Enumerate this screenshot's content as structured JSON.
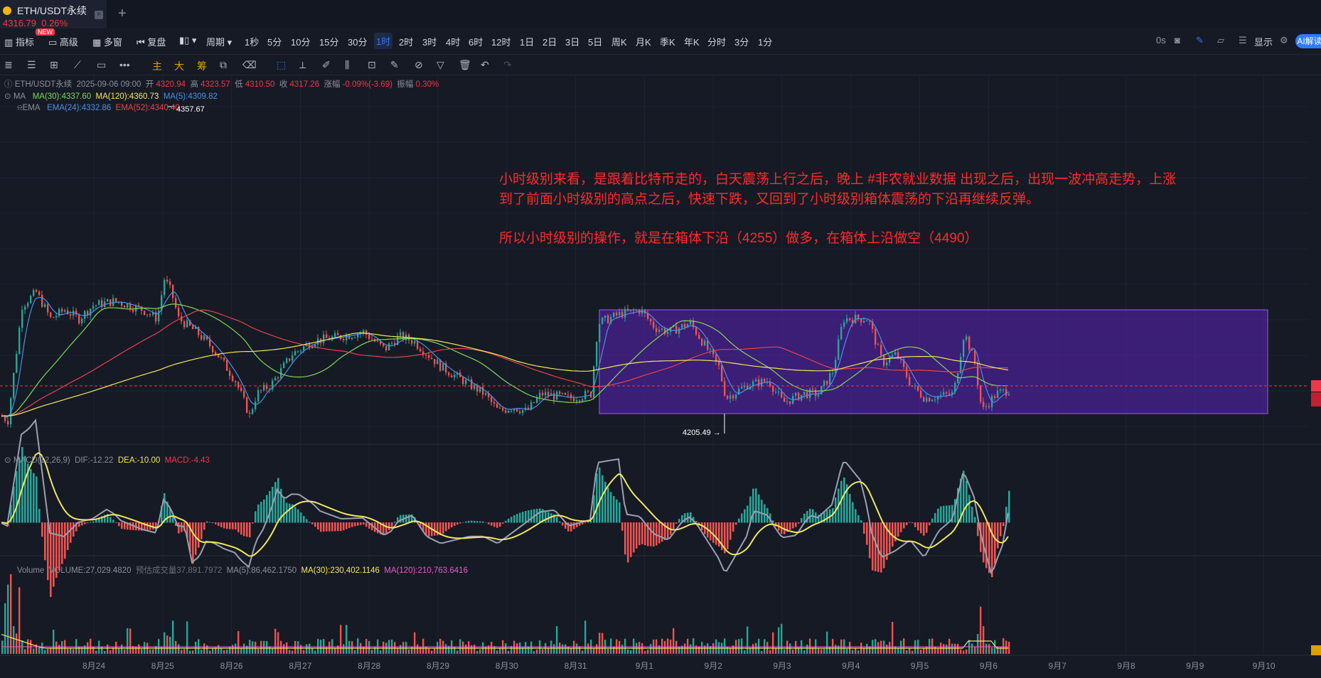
{
  "tab": {
    "symbol": "ETH/USDT永续",
    "price": "4316.79",
    "change": "0.26%",
    "close": "×",
    "new_tab": "+"
  },
  "toolbar": {
    "new_badge": "NEW",
    "items": [
      "指标",
      "高级",
      "多窗",
      "复盘",
      "周期",
      "1秒",
      "5分",
      "10分",
      "15分",
      "30分",
      "1时",
      "2时",
      "3时",
      "4时",
      "6时",
      "12时",
      "1日",
      "2日",
      "3日",
      "5日",
      "周K",
      "月K",
      "季K",
      "年K",
      "分时",
      "3分",
      "1分"
    ],
    "active": "1时",
    "right_countdown": "0s",
    "display": "显示",
    "ai": "AI解读"
  },
  "drawing_toolbar": {
    "main": "主",
    "big": "大",
    "chips": "筹"
  },
  "legend": {
    "symbol": "ETH/USDT永续",
    "datetime": "2025-09-06 09:00",
    "open_label": "开",
    "open": "4320.94",
    "high_label": "高",
    "high": "4323.57",
    "low_label": "低",
    "low": "4310.50",
    "close_label": "收",
    "close": "4317.26",
    "chg_label": "涨幅",
    "chg": "-0.09%(-3.69)",
    "amp_label": "振幅",
    "amp": "0.30%",
    "ma_label": "MA",
    "ma30": "MA(30):4337.60",
    "ma120": "MA(120):4360.73",
    "ma5": "MA(5):4309.82",
    "ema_label": "EMA",
    "ema24": "EMA(24):4332.86",
    "ema52": "EMA(52):4340.40",
    "macd_label": "MACD(12,26,9)",
    "dif": "DIF:-12.22",
    "dea": "DEA:-10.00",
    "macd": "MACD:-4.43",
    "vol_label": "Volume",
    "volume": "VOLUME:27,029.4820",
    "est_label": "预估成交量",
    "est": "37,891.7972",
    "vma5": "MA(5):86,462.1750",
    "vma30": "MA(30):230,402.1146",
    "vma120": "MA(120):210,763.6416"
  },
  "annotations": {
    "high": "4357.67",
    "low": "4205.49 →",
    "line1": "小时级别来看，是跟着比特币走的，白天震荡上行之后，晚上 #非农就业数据 出现之后，出现一波冲高走势，上涨",
    "line2": "到了前面小时级别的高点之后，快速下跌，又回到了小时级别箱体震荡的下沿再继续反弹。",
    "line3": "所以小时级别的操作，就是在箱体下沿（4255）做多，在箱体上沿做空（4490）"
  },
  "chart_data": {
    "type": "candlestick",
    "x_ticks": [
      "8月24",
      "8月25",
      "8月26",
      "8月27",
      "8月28",
      "8月29",
      "8月30",
      "8月31",
      "9月1",
      "9月2",
      "9月3",
      "9月4",
      "9月5",
      "9月6",
      "9月7",
      "9月8",
      "9月9",
      "9月10"
    ],
    "box": {
      "upper": 4490,
      "lower": 4255
    },
    "marked_high": 4357.67,
    "marked_low": 4205.49,
    "colors": {
      "up": "#26a69a",
      "down": "#ef5350",
      "ma5": "#4a90e2",
      "ma30": "#7ed957",
      "ma120": "#f2e85a",
      "ema52": "#e8424c",
      "box": "#7b2fd6"
    }
  }
}
